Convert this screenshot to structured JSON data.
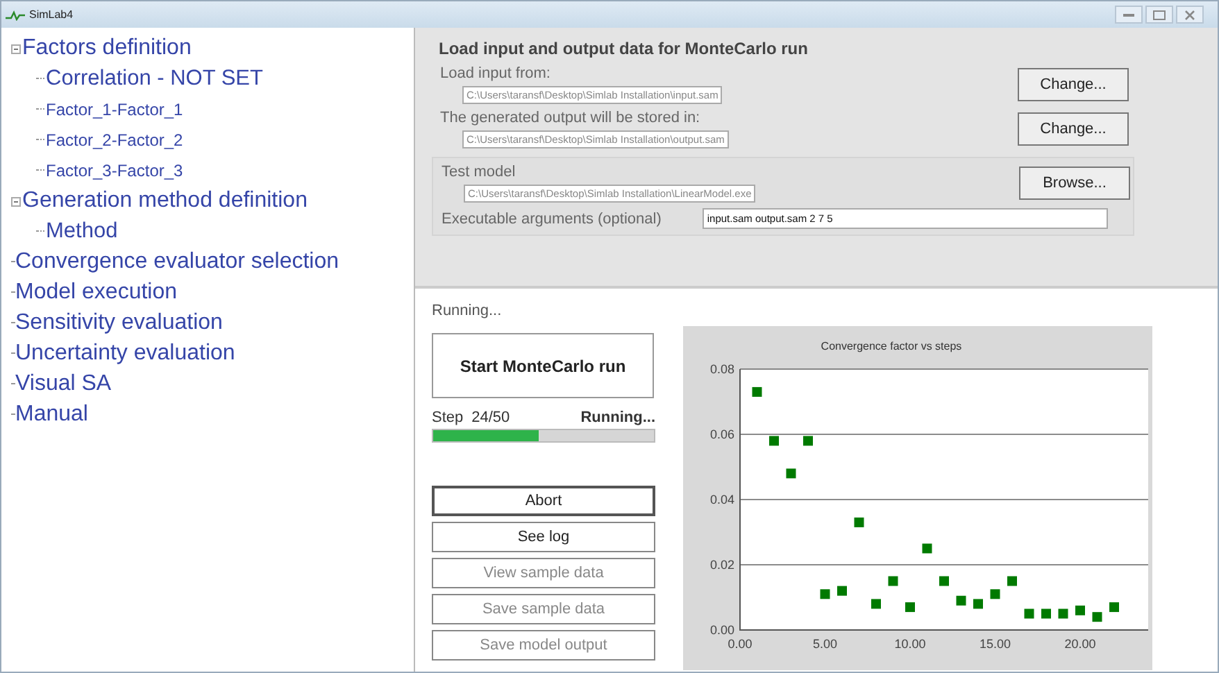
{
  "window": {
    "title": "SimLab4"
  },
  "tree": [
    {
      "label": "Factors definition",
      "kind": "heading",
      "expanded": true,
      "children": [
        {
          "label": "Correlation - NOT SET",
          "kind": "sub"
        },
        {
          "label": "Factor_1-Factor_1",
          "kind": "factor"
        },
        {
          "label": "Factor_2-Factor_2",
          "kind": "factor"
        },
        {
          "label": "Factor_3-Factor_3",
          "kind": "factor"
        }
      ]
    },
    {
      "label": "Generation method definition",
      "kind": "heading",
      "expanded": true,
      "children": [
        {
          "label": "Method",
          "kind": "sub"
        }
      ]
    },
    {
      "label": "Convergence evaluator selection",
      "kind": "heading"
    },
    {
      "label": "Model execution",
      "kind": "heading"
    },
    {
      "label": "Sensitivity evaluation",
      "kind": "heading"
    },
    {
      "label": "Uncertainty evaluation",
      "kind": "heading"
    },
    {
      "label": "Visual SA",
      "kind": "heading"
    },
    {
      "label": "Manual",
      "kind": "heading"
    }
  ],
  "load": {
    "title": "Load input and output data for MonteCarlo run",
    "rows": [
      {
        "label": "Load input from:",
        "value": "C:\\Users\\taransf\\Desktop\\Simlab Installation\\input.sam",
        "button": "Change..."
      },
      {
        "label": "The generated output will be stored in:",
        "value": "C:\\Users\\taransf\\Desktop\\Simlab Installation\\output.sam",
        "button": "Change..."
      }
    ],
    "model": {
      "label": "Test model",
      "value": "C:\\Users\\taransf\\Desktop\\Simlab Installation\\LinearModel.exe",
      "button": "Browse...",
      "args_label": "Executable arguments (optional)",
      "args_value": "input.sam output.sam 2 7 5"
    }
  },
  "run": {
    "status": "Running...",
    "start_button": "Start MonteCarlo run",
    "step_label": "Step",
    "step": "24/50",
    "step_status": "Running...",
    "progress": {
      "level": 0.48
    },
    "buttons": [
      {
        "label": "Abort",
        "disabled": false,
        "focused": true
      },
      {
        "label": "See log",
        "disabled": false,
        "focused": false
      },
      {
        "label": "View sample data",
        "disabled": true,
        "focused": false
      },
      {
        "label": "Save sample data",
        "disabled": true,
        "focused": false
      },
      {
        "label": "Save model output",
        "disabled": true,
        "focused": false
      }
    ]
  },
  "chart": {
    "chart_data": {
      "type": "scatter",
      "title": "Convergence factor vs steps",
      "x": [
        1,
        2,
        3,
        4,
        5,
        6,
        7,
        8,
        9,
        10,
        11,
        12,
        13,
        14,
        15,
        16,
        17,
        18,
        19,
        20,
        21,
        22
      ],
      "series": [
        {
          "color": "#007a00",
          "values": [
            0.073,
            0.058,
            0.048,
            0.058,
            0.011,
            0.012,
            0.033,
            0.008,
            0.015,
            0.007,
            0.025,
            0.015,
            0.009,
            0.008,
            0.011,
            0.015,
            0.005,
            0.005,
            0.005,
            0.006,
            0.004,
            0.007
          ]
        }
      ],
      "xlim": [
        0,
        24
      ],
      "ylim": [
        0,
        0.08
      ],
      "grid": true,
      "xticks": [
        {
          "value": 0,
          "label": "0.00"
        },
        {
          "value": 5,
          "label": "5.00"
        },
        {
          "value": 10,
          "label": "10.00"
        },
        {
          "value": 15,
          "label": "15.00"
        },
        {
          "value": 20,
          "label": "20.00"
        }
      ],
      "yticks": [
        {
          "value": 0,
          "label": "0.00"
        },
        {
          "value": 0.02,
          "label": "0.02"
        },
        {
          "value": 0.04,
          "label": "0.04"
        },
        {
          "value": 0.06,
          "label": "0.06"
        },
        {
          "value": 0.08,
          "label": "0.08"
        }
      ]
    }
  }
}
